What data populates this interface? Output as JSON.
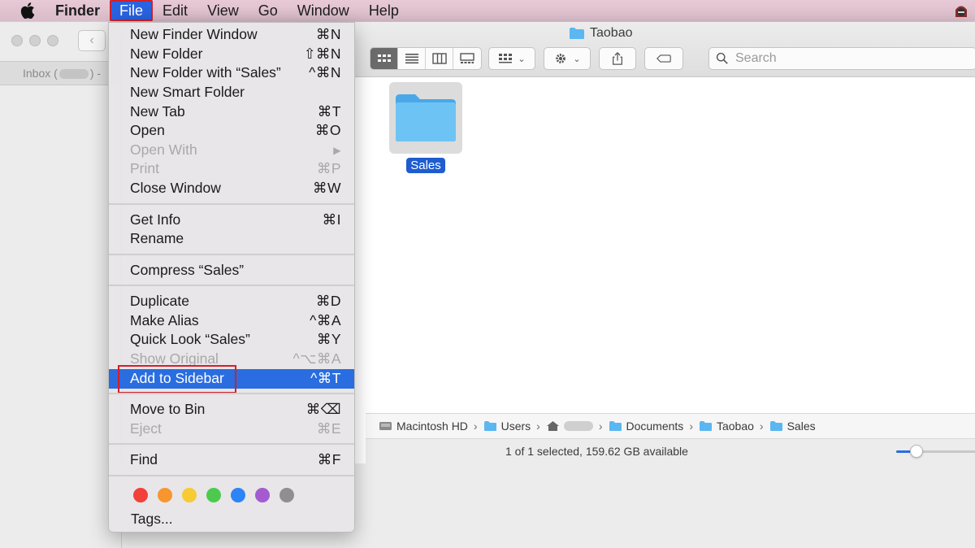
{
  "menubar": {
    "app_name": "Finder",
    "menus": [
      "File",
      "Edit",
      "View",
      "Go",
      "Window",
      "Help"
    ]
  },
  "background_window": {
    "tab_label_start": "Inbox (",
    "tab_label_end": ") - "
  },
  "finder": {
    "title": "Taobao",
    "search_placeholder": "Search",
    "selected_item": "Sales",
    "path": [
      "Macintosh HD",
      "Users",
      "Documents",
      "Taobao",
      "Sales"
    ],
    "status": "1 of 1 selected, 159.62 GB available",
    "icon_size_level": 0.25
  },
  "file_menu": {
    "items": [
      {
        "label": "New Finder Window",
        "shortcut": "⌘N"
      },
      {
        "label": "New Folder",
        "shortcut": "⇧⌘N"
      },
      {
        "label": "New Folder with “Sales”",
        "shortcut": "^⌘N"
      },
      {
        "label": "New Smart Folder",
        "shortcut": ""
      },
      {
        "label": "New Tab",
        "shortcut": "⌘T"
      },
      {
        "label": "Open",
        "shortcut": "⌘O"
      },
      {
        "label": "Open With",
        "shortcut": "▶"
      },
      {
        "label": "Print",
        "shortcut": "⌘P"
      },
      {
        "label": "Close Window",
        "shortcut": "⌘W"
      },
      {
        "label": "Get Info",
        "shortcut": "⌘I"
      },
      {
        "label": "Rename",
        "shortcut": ""
      },
      {
        "label": "Compress “Sales”",
        "shortcut": ""
      },
      {
        "label": "Duplicate",
        "shortcut": "⌘D"
      },
      {
        "label": "Make Alias",
        "shortcut": "^⌘A"
      },
      {
        "label": "Quick Look “Sales”",
        "shortcut": "⌘Y"
      },
      {
        "label": "Show Original",
        "shortcut": "^⌥⌘A"
      },
      {
        "label": "Add to Sidebar",
        "shortcut": "^⌘T"
      },
      {
        "label": "Move to Bin",
        "shortcut": "⌘⌫"
      },
      {
        "label": "Eject",
        "shortcut": "⌘E"
      },
      {
        "label": "Find",
        "shortcut": "⌘F"
      },
      {
        "label": "Tags...",
        "shortcut": ""
      }
    ],
    "tag_colors": [
      "#f2413b",
      "#f7962f",
      "#f6cb34",
      "#4dca4e",
      "#2d84f4",
      "#a45bd0",
      "#8e8e93"
    ]
  },
  "colors": {
    "accent": "#2a6de0",
    "highlight_box": "#d21f2c",
    "folder_blue": "#5ab7f1"
  }
}
